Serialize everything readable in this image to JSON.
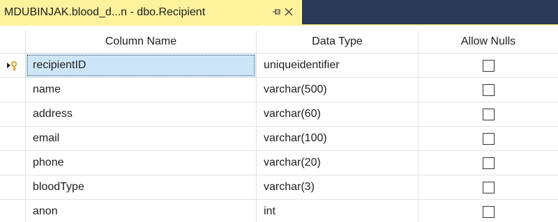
{
  "tab": {
    "title": "MDUBINJAK.blood_d...n - dbo.Recipient",
    "pin_icon": "pin-icon",
    "close_icon": "close-icon"
  },
  "grid": {
    "headers": {
      "column_name": "Column Name",
      "data_type": "Data Type",
      "allow_nulls": "Allow Nulls"
    },
    "rows": [
      {
        "name": "recipientID",
        "type": "uniqueidentifier",
        "allow_nulls": false,
        "primary_key": true
      },
      {
        "name": "name",
        "type": "varchar(500)",
        "allow_nulls": false
      },
      {
        "name": "address",
        "type": "varchar(60)",
        "allow_nulls": false
      },
      {
        "name": "email",
        "type": "varchar(100)",
        "allow_nulls": false
      },
      {
        "name": "phone",
        "type": "varchar(20)",
        "allow_nulls": false
      },
      {
        "name": "bloodType",
        "type": "varchar(3)",
        "allow_nulls": false
      },
      {
        "name": "anon",
        "type": "int",
        "allow_nulls": false
      }
    ]
  },
  "colors": {
    "tab_active": "#fff29d",
    "tabstrip_bg": "#293955",
    "selection": "#cde6f7",
    "key_icon": "#d4a017"
  }
}
